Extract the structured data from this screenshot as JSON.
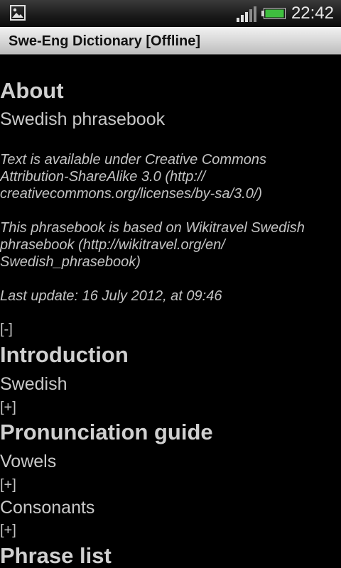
{
  "status_bar": {
    "time": "22:42",
    "icons": [
      "gallery-icon",
      "signal-icon",
      "battery-icon"
    ],
    "battery_color": "#3fbf3f"
  },
  "title_bar": {
    "title": "Swe-Eng Dictionary [Offline]"
  },
  "content": {
    "about": {
      "heading": "About",
      "subtitle": "Swedish phrasebook",
      "license_text": "Text is available under Creative Commons Attribution-ShareAlike 3.0 (http:// creativecommons.org/licenses/by-sa/3.0/)",
      "source_text": "This phrasebook is based on Wikitravel Swedish phrasebook (http://wikitravel.org/en/ Swedish_phrasebook)",
      "last_update": "Last update: 16 July 2012, at 09:46",
      "toggle": "[-]"
    },
    "introduction": {
      "heading": "Introduction",
      "items": [
        {
          "label": "Swedish",
          "toggle": "[+]"
        }
      ]
    },
    "pronunciation": {
      "heading": "Pronunciation guide",
      "items": [
        {
          "label": "Vowels",
          "toggle": "[+]"
        },
        {
          "label": "Consonants",
          "toggle": "[+]"
        }
      ]
    },
    "phrase_list": {
      "heading": "Phrase list"
    }
  }
}
